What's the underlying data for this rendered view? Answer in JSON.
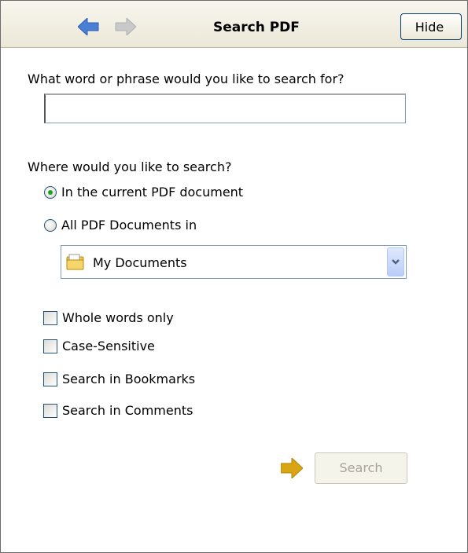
{
  "header": {
    "title": "Search PDF",
    "hide_label": "Hide",
    "back_icon": "back-arrow-icon",
    "forward_icon": "forward-arrow-icon"
  },
  "query": {
    "prompt": "What word or phrase would you like to search for?",
    "value": ""
  },
  "scope": {
    "prompt": "Where would you like to search?",
    "options": [
      {
        "label": "In the current PDF document",
        "selected": true
      },
      {
        "label": "All PDF Documents in",
        "selected": false
      }
    ],
    "location": {
      "value": "My Documents",
      "icon": "folder-icon"
    }
  },
  "options": [
    {
      "label": "Whole words only",
      "checked": false
    },
    {
      "label": "Case-Sensitive",
      "checked": false
    },
    {
      "label": "Search in Bookmarks",
      "checked": false
    },
    {
      "label": "Search in Comments",
      "checked": false
    }
  ],
  "search_button": {
    "label": "Search",
    "enabled": false
  },
  "colors": {
    "accent_arrow": "#d9a514",
    "nav_arrow": "#4a7fd6",
    "radio_dot": "#21a121"
  }
}
